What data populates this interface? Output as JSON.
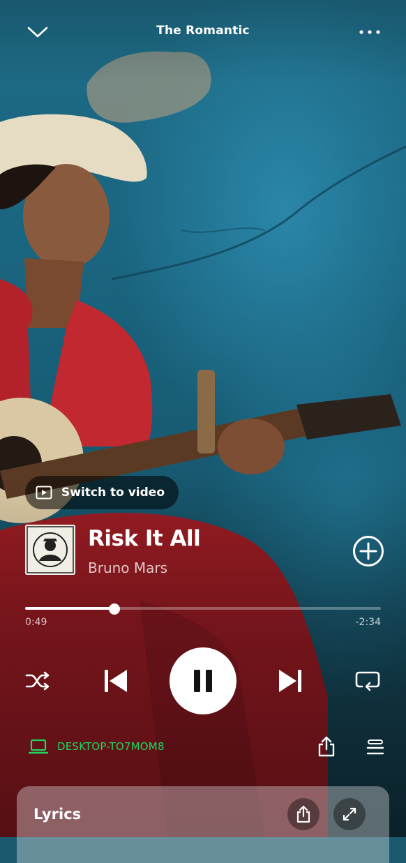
{
  "header": {
    "title": "The Romantic",
    "collapse_icon": "chevron-down-icon",
    "more_icon": "more-dots-icon"
  },
  "video_toggle": {
    "label": "Switch to video",
    "icon": "play-video-icon"
  },
  "track": {
    "title": "Risk It All",
    "artist": "Bruno Mars",
    "add_icon": "plus-circle-icon"
  },
  "playback": {
    "elapsed": "0:49",
    "remaining": "-2:34",
    "progress_fraction": 0.25,
    "state": "playing"
  },
  "controls": {
    "shuffle_icon": "shuffle-icon",
    "previous_icon": "skip-previous-icon",
    "pause_icon": "pause-icon",
    "next_icon": "skip-next-icon",
    "repeat_icon": "repeat-icon"
  },
  "device": {
    "name": "DESKTOP-TO7MOM8",
    "icon": "laptop-icon",
    "color": "#1ed760"
  },
  "footer": {
    "share_icon": "share-icon",
    "queue_icon": "queue-icon"
  },
  "lyrics": {
    "title": "Lyrics",
    "share_icon": "share-icon",
    "expand_icon": "expand-icon"
  }
}
